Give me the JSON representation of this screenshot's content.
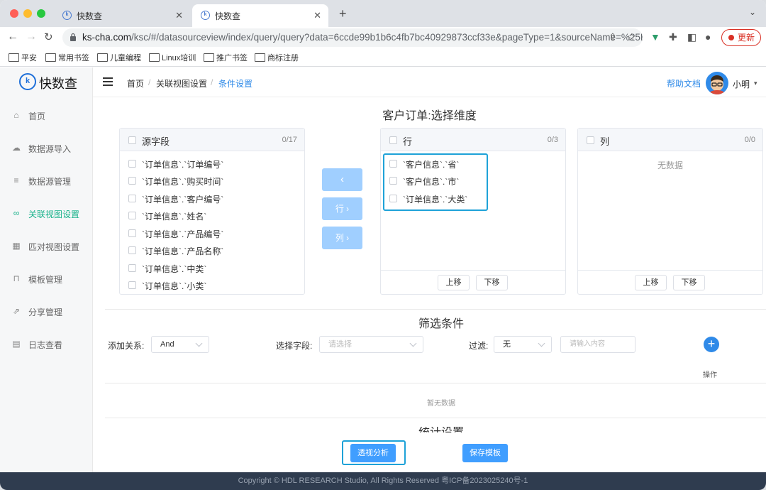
{
  "browser": {
    "tabs": [
      {
        "title": "快数查",
        "fav": "k"
      },
      {
        "title": "快数查",
        "fav": "k"
      }
    ],
    "url_host": "ks-cha.com",
    "url_path": "/ksc/#/datasourceview/index/query/query?data=6ccde99b1b6c4fb7bc40929873ccf33e&pageType=1&sourceName=%25E...",
    "update_label": "更新",
    "bookmarks": [
      "平安",
      "常用书签",
      "儿童编程",
      "Linux培训",
      "推广书签",
      "商标注册"
    ]
  },
  "app": {
    "logo_text": "快数查",
    "logo_mark": "k",
    "menu": [
      {
        "label": "首页",
        "icon": "home-icon",
        "glyph": "⌂"
      },
      {
        "label": "数据源导入",
        "icon": "cloud-upload-icon",
        "glyph": "☁"
      },
      {
        "label": "数据源管理",
        "icon": "database-icon",
        "glyph": "≡"
      },
      {
        "label": "关联视图设置",
        "icon": "link-icon",
        "glyph": "∞"
      },
      {
        "label": "匹对视图设置",
        "icon": "grid-icon",
        "glyph": "▦"
      },
      {
        "label": "模板管理",
        "icon": "bag-icon",
        "glyph": "⊓"
      },
      {
        "label": "分享管理",
        "icon": "share-icon",
        "glyph": "⇗"
      },
      {
        "label": "日志查看",
        "icon": "log-icon",
        "glyph": "▤"
      }
    ],
    "breadcrumb": [
      "首页",
      "关联视图设置",
      "条件设置"
    ],
    "breadcrumb_sep": "/",
    "help_label": "帮助文档",
    "user_name": "小明",
    "user_caret": "▾",
    "accent_color": "#18b28a",
    "primary_color": "#409eff"
  },
  "dimension": {
    "title": "客户订单:选择维度",
    "source": {
      "title": "源字段",
      "count": "0/17",
      "items": [
        "`订单信息`.`订单编号`",
        "`订单信息`.`购买时间`",
        "`订单信息`.`客户编号`",
        "`订单信息`.`姓名`",
        "`订单信息`.`产品编号`",
        "`订单信息`.`产品名称`",
        "`订单信息`.`中类`",
        "`订单信息`.`小类`"
      ]
    },
    "transfer": {
      "back": "‹",
      "to_row": "行 ›",
      "to_col": "列 ›"
    },
    "row": {
      "title": "行",
      "count": "0/3",
      "items": [
        "`客户信息`.`省`",
        "`客户信息`.`市`",
        "`订单信息`.`大类`"
      ],
      "up": "上移",
      "down": "下移"
    },
    "col": {
      "title": "列",
      "count": "0/0",
      "empty": "无数据",
      "up": "上移",
      "down": "下移"
    }
  },
  "filter": {
    "title": "筛选条件",
    "relation_label": "添加关系:",
    "relation_value": "And",
    "field_label": "选择字段:",
    "field_placeholder": "请选择",
    "filter_label": "过滤:",
    "filter_value": "无",
    "input_placeholder": "请输入内容",
    "add_icon": "+",
    "op_header": "操作",
    "empty": "暂无数据",
    "next_section": "统计设置"
  },
  "actions": {
    "analyze": "透视分析",
    "save": "保存模板"
  },
  "footer": "Copyright © HDL RESEARCH Studio, All Rights Reserved     粤ICP备2023025240号-1"
}
